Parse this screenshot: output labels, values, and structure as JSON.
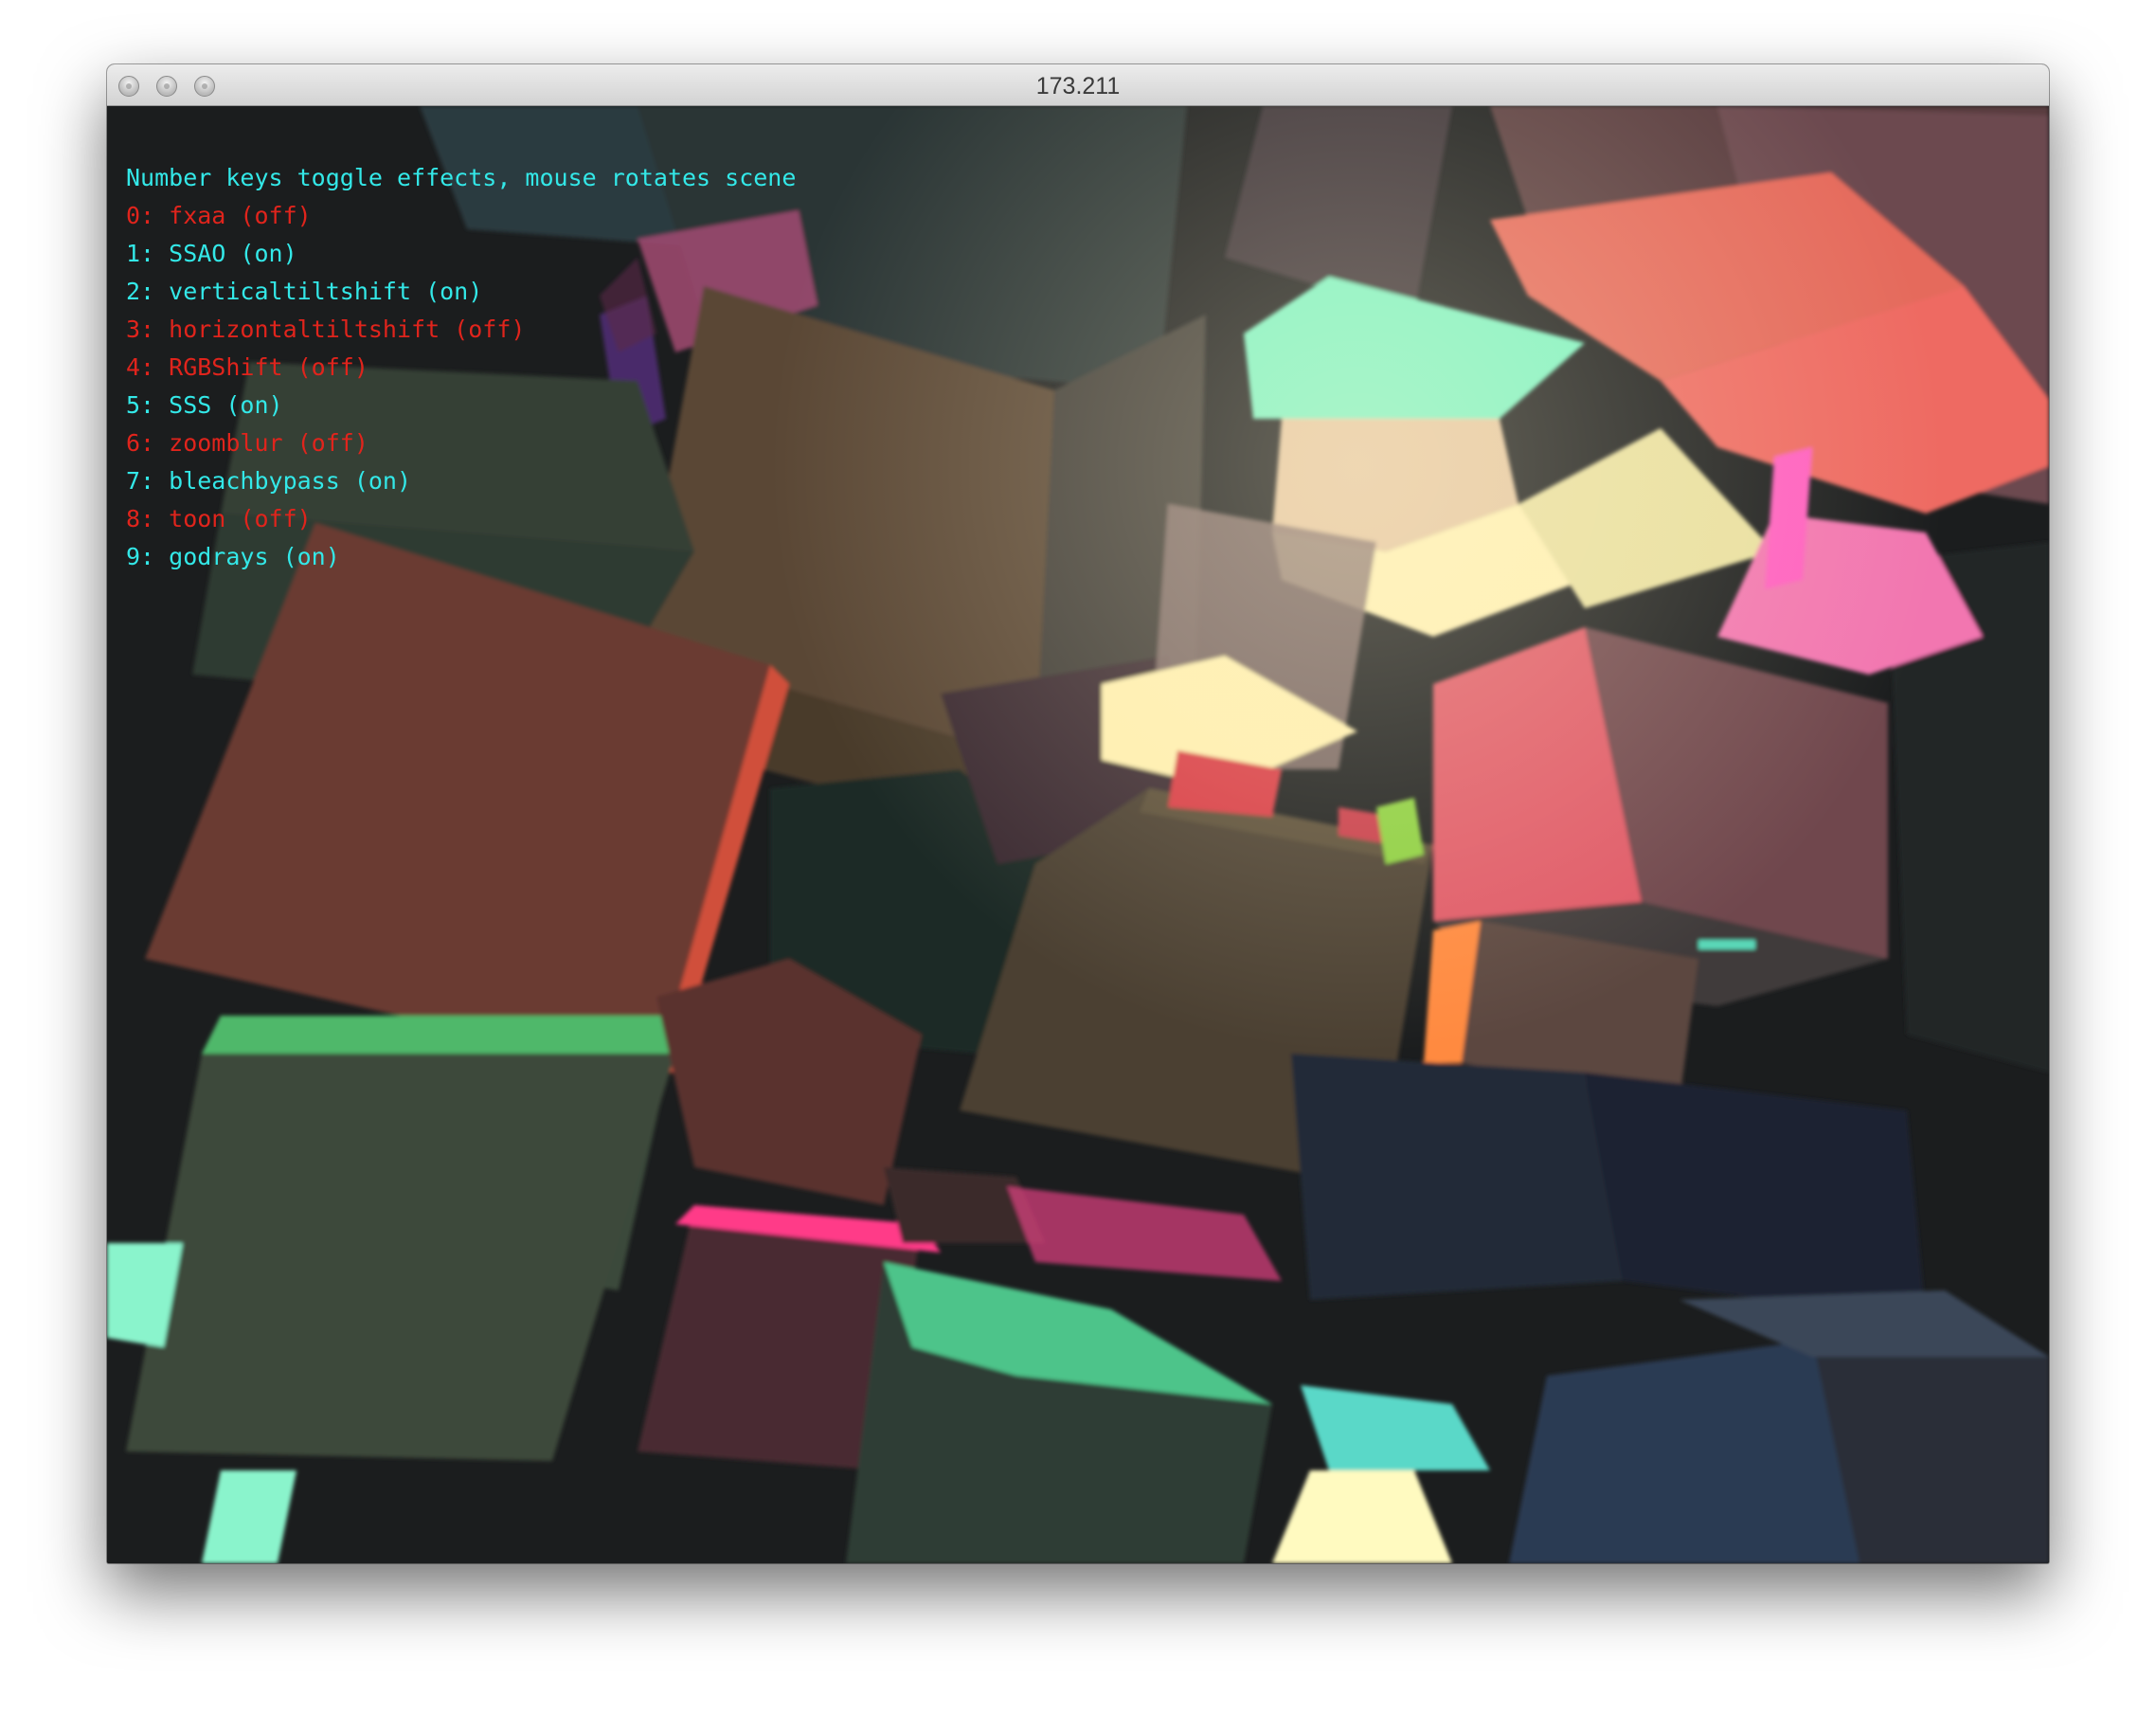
{
  "window": {
    "title": "173.211"
  },
  "hud": {
    "header": "Number keys toggle effects, mouse rotates scene",
    "on_color": "#33e8e8",
    "off_color": "#e0241c",
    "effects": [
      {
        "text": "0: fxaa (off)",
        "enabled": false
      },
      {
        "text": "1: SSAO (on)",
        "enabled": true
      },
      {
        "text": "2: verticaltiltshift (on)",
        "enabled": true
      },
      {
        "text": "3: horizontaltiltshift (off)",
        "enabled": false
      },
      {
        "text": "4: RGBShift (off)",
        "enabled": false
      },
      {
        "text": "5: SSS (on)",
        "enabled": true
      },
      {
        "text": "6: zoomblur (off)",
        "enabled": false
      },
      {
        "text": "7: bleachbypass (on)",
        "enabled": true
      },
      {
        "text": "8: toon (off)",
        "enabled": false
      },
      {
        "text": "9: godrays (on)",
        "enabled": true
      }
    ]
  },
  "icons": {
    "close": "close-button-icon",
    "minimize": "minimize-button-icon",
    "zoom": "zoom-button-icon"
  }
}
